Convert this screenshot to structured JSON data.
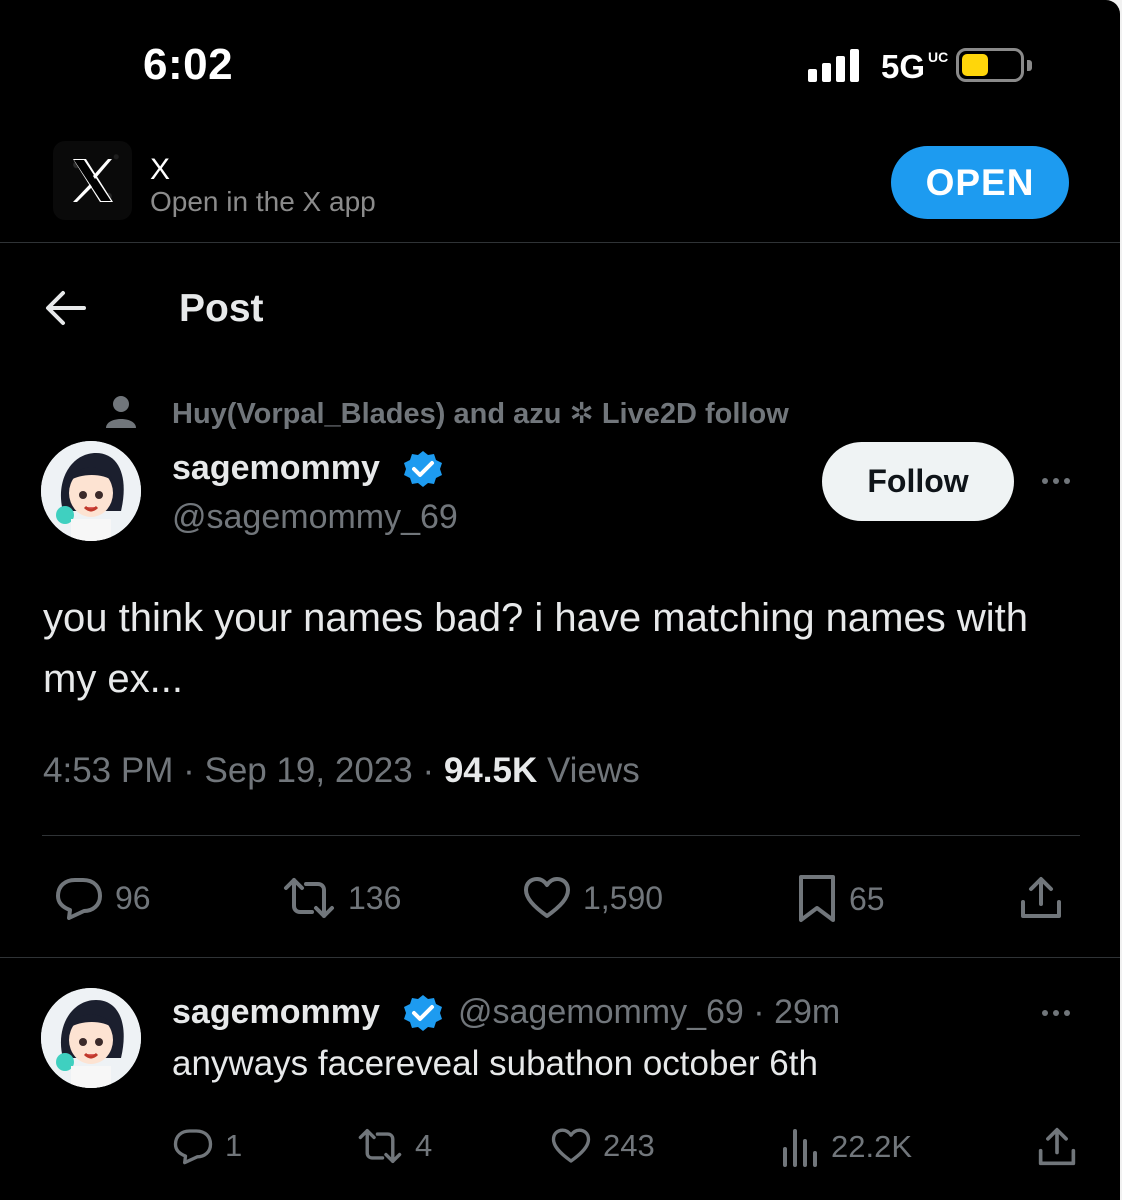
{
  "status_bar": {
    "time": "6:02",
    "network": "5G",
    "network_suffix": "UC",
    "battery_color": "#ffd60a"
  },
  "app_banner": {
    "icon": "x-logo-icon",
    "title": "X",
    "subtitle": "Open in the X app",
    "open_label": "OPEN"
  },
  "header": {
    "title": "Post",
    "back_icon": "back-arrow-icon"
  },
  "social_context": {
    "icon": "person-icon",
    "text": "Huy(Vorpal_Blades) and azu ✲ Live2D follow"
  },
  "post": {
    "display_name": "sagemommy",
    "verified": true,
    "handle": "@sagemommy_69",
    "follow_label": "Follow",
    "text": "you think your names bad? i have matching names with my ex...",
    "time": "4:53 PM",
    "date": "Sep 19, 2023",
    "views_count": "94.5K",
    "views_label": "Views",
    "actions": {
      "replies": "96",
      "reposts": "136",
      "likes": "1,590",
      "bookmarks": "65"
    }
  },
  "reply": {
    "display_name": "sagemommy",
    "handle": "@sagemommy_69",
    "age": "29m",
    "text": "anyways facereveal subathon october 6th",
    "actions": {
      "replies": "1",
      "reposts": "4",
      "likes": "243",
      "views": "22.2K"
    }
  },
  "colors": {
    "accent": "#1d9bf0",
    "text_primary": "#e7e9ea",
    "text_secondary": "#71767b",
    "background": "#000000"
  }
}
